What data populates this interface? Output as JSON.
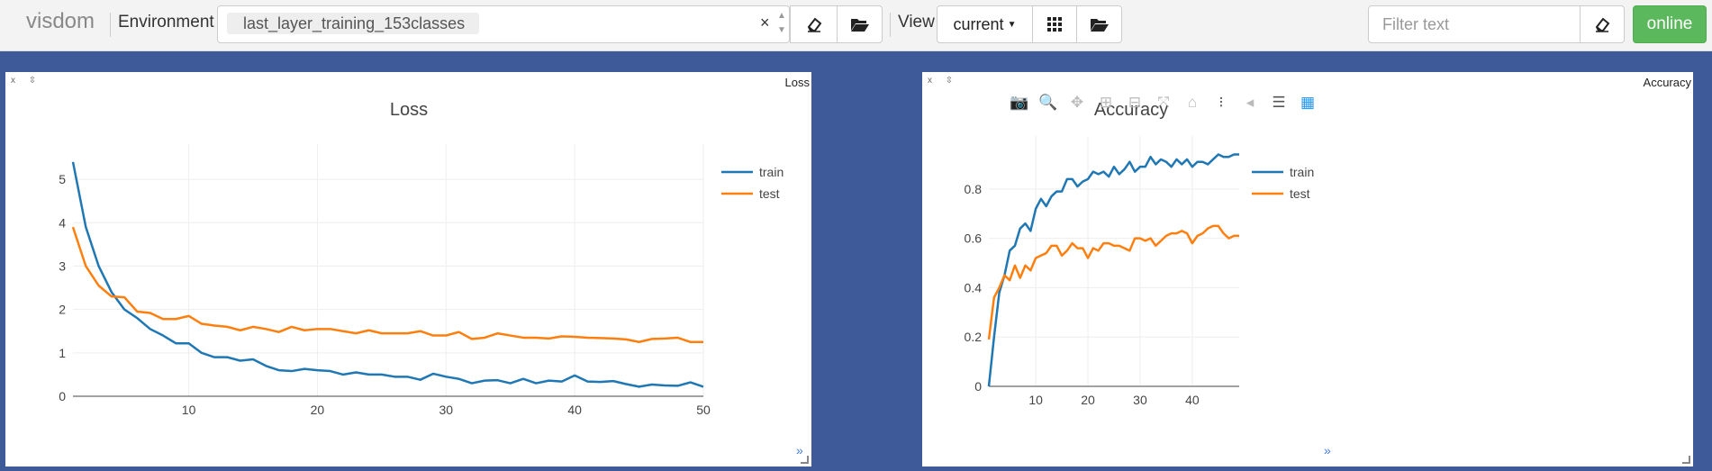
{
  "app": {
    "name": "visdom"
  },
  "toolbar": {
    "environment_label": "Environment",
    "environment_value": "last_layer_training_153classes",
    "clear_icon": "×",
    "view_label": "View",
    "view_value": "current",
    "filter_placeholder": "Filter text",
    "online_label": "online"
  },
  "panes": [
    {
      "title": "Loss",
      "controls": "x ⇳"
    },
    {
      "title": "Accuracy",
      "controls": "x ⇳"
    }
  ],
  "modebar": {
    "icons": [
      "camera-icon",
      "zoom-icon",
      "pan-icon",
      "zoom-in-icon",
      "zoom-out-icon",
      "autoscale-icon",
      "reset-axes-icon",
      "spike-lines-icon",
      "hover-closest-icon",
      "hover-compare-icon",
      "plotly-logo-icon"
    ]
  },
  "colors": {
    "train": "#1f77b4",
    "test": "#ff7f0e",
    "online": "#5cb85c",
    "background": "#3f5a99"
  },
  "chart_data": [
    {
      "type": "line",
      "title": "Loss",
      "xlabel": "",
      "ylabel": "",
      "xlim": [
        1,
        50
      ],
      "ylim": [
        0,
        5.5
      ],
      "xticks": [
        10,
        20,
        30,
        40,
        50
      ],
      "yticks": [
        0,
        1,
        2,
        3,
        4,
        5
      ],
      "grid": true,
      "legend": "top-right",
      "x": [
        1,
        2,
        3,
        4,
        5,
        6,
        7,
        8,
        9,
        10,
        11,
        12,
        13,
        14,
        15,
        16,
        17,
        18,
        19,
        20,
        21,
        22,
        23,
        24,
        25,
        26,
        27,
        28,
        29,
        30,
        31,
        32,
        33,
        34,
        35,
        36,
        37,
        38,
        39,
        40,
        41,
        42,
        43,
        44,
        45,
        46,
        47,
        48,
        49,
        50
      ],
      "series": [
        {
          "name": "train",
          "values": [
            5.4,
            3.9,
            3.0,
            2.4,
            2.0,
            1.8,
            1.55,
            1.4,
            1.22,
            1.22,
            1.0,
            0.9,
            0.9,
            0.82,
            0.85,
            0.7,
            0.6,
            0.58,
            0.63,
            0.6,
            0.58,
            0.5,
            0.55,
            0.5,
            0.5,
            0.45,
            0.45,
            0.38,
            0.52,
            0.45,
            0.4,
            0.3,
            0.36,
            0.37,
            0.3,
            0.4,
            0.3,
            0.36,
            0.34,
            0.48,
            0.34,
            0.33,
            0.35,
            0.28,
            0.22,
            0.27,
            0.25,
            0.24,
            0.32,
            0.22
          ]
        },
        {
          "name": "test",
          "values": [
            3.9,
            3.0,
            2.55,
            2.3,
            2.28,
            1.95,
            1.92,
            1.78,
            1.78,
            1.85,
            1.67,
            1.63,
            1.6,
            1.52,
            1.6,
            1.55,
            1.48,
            1.6,
            1.52,
            1.55,
            1.55,
            1.5,
            1.45,
            1.52,
            1.45,
            1.45,
            1.45,
            1.5,
            1.4,
            1.4,
            1.48,
            1.32,
            1.35,
            1.45,
            1.4,
            1.35,
            1.35,
            1.33,
            1.38,
            1.37,
            1.35,
            1.34,
            1.33,
            1.31,
            1.25,
            1.32,
            1.33,
            1.35,
            1.25,
            1.25
          ]
        }
      ]
    },
    {
      "type": "line",
      "title": "Accuracy",
      "xlabel": "",
      "ylabel": "",
      "xlim": [
        1,
        49
      ],
      "ylim": [
        0,
        0.96
      ],
      "xticks": [
        10,
        20,
        30,
        40
      ],
      "yticks": [
        0,
        0.2,
        0.4,
        0.6,
        0.8
      ],
      "grid": true,
      "legend": "top-right",
      "x": [
        1,
        2,
        3,
        4,
        5,
        6,
        7,
        8,
        9,
        10,
        11,
        12,
        13,
        14,
        15,
        16,
        17,
        18,
        19,
        20,
        21,
        22,
        23,
        24,
        25,
        26,
        27,
        28,
        29,
        30,
        31,
        32,
        33,
        34,
        35,
        36,
        37,
        38,
        39,
        40,
        41,
        42,
        43,
        44,
        45,
        46,
        47,
        48,
        49
      ],
      "series": [
        {
          "name": "train",
          "values": [
            0.0,
            0.2,
            0.38,
            0.45,
            0.55,
            0.57,
            0.64,
            0.66,
            0.63,
            0.72,
            0.76,
            0.73,
            0.77,
            0.79,
            0.79,
            0.84,
            0.84,
            0.81,
            0.83,
            0.84,
            0.87,
            0.86,
            0.87,
            0.85,
            0.89,
            0.86,
            0.88,
            0.91,
            0.87,
            0.89,
            0.89,
            0.93,
            0.9,
            0.92,
            0.91,
            0.89,
            0.92,
            0.9,
            0.92,
            0.89,
            0.91,
            0.91,
            0.9,
            0.92,
            0.94,
            0.93,
            0.93,
            0.94,
            0.94
          ]
        },
        {
          "name": "test",
          "values": [
            0.19,
            0.36,
            0.4,
            0.45,
            0.43,
            0.49,
            0.44,
            0.49,
            0.47,
            0.52,
            0.53,
            0.54,
            0.57,
            0.57,
            0.53,
            0.55,
            0.58,
            0.56,
            0.56,
            0.52,
            0.56,
            0.55,
            0.58,
            0.58,
            0.57,
            0.57,
            0.56,
            0.55,
            0.6,
            0.6,
            0.59,
            0.6,
            0.57,
            0.59,
            0.61,
            0.62,
            0.62,
            0.63,
            0.62,
            0.58,
            0.61,
            0.62,
            0.64,
            0.65,
            0.65,
            0.62,
            0.6,
            0.61,
            0.61
          ]
        }
      ]
    }
  ]
}
